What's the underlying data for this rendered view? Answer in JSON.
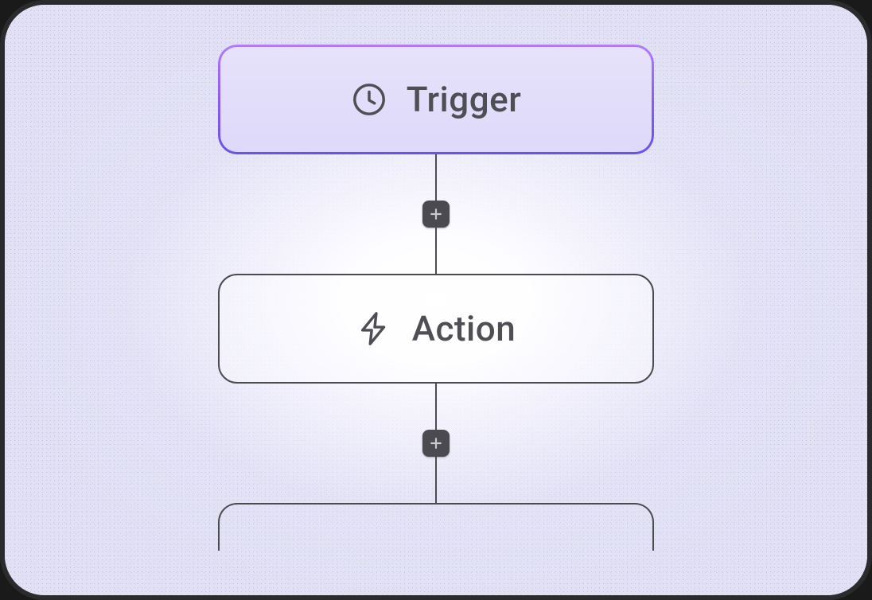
{
  "flow": {
    "trigger": {
      "label": "Trigger",
      "icon": "clock-icon"
    },
    "action": {
      "label": "Action",
      "icon": "bolt-icon"
    }
  },
  "colors": {
    "trigger_border_gradient": [
      "#b07cff",
      "#6a52ea"
    ],
    "trigger_fill": "#e1dcf9",
    "node_text": "#4e4e55",
    "connector": "#4b4b50",
    "add_button_bg": "#4a4a50"
  }
}
